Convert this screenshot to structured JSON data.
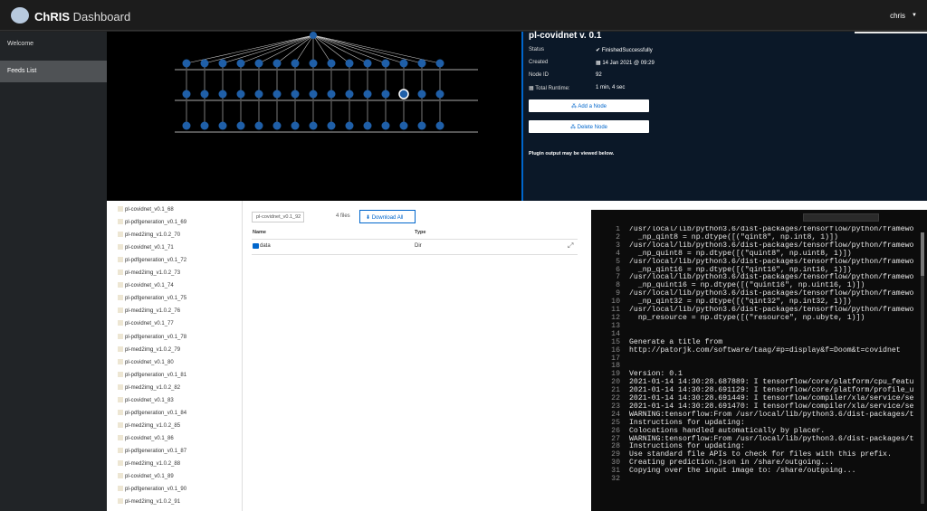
{
  "header": {
    "brand_bold": "ChRIS",
    "brand_rest": "Dashboard",
    "user": "chris"
  },
  "sidebar": {
    "items": [
      {
        "label": "Welcome"
      },
      {
        "label": "Feeds List"
      }
    ]
  },
  "node_detail": {
    "title": "pl-covidnet v. 0.1",
    "rows": [
      {
        "label": "Status",
        "value": "FinishedSuccessfully"
      },
      {
        "label": "Created",
        "value": "14 Jan 2021 @ 09:29"
      },
      {
        "label": "Node ID",
        "value": "92"
      },
      {
        "label": "Total Runtime:",
        "value": "1 min, 4 sec"
      }
    ],
    "add_node": "Add a Node",
    "delete_node": "Delete Node",
    "plugin_message": "Plugin output may be viewed below."
  },
  "feed_list": [
    "pl-covidnet_v0.1_68",
    "pl-pdfgeneration_v0.1_69",
    "pl-med2img_v1.0.2_70",
    "pl-covidnet_v0.1_71",
    "pl-pdfgeneration_v0.1_72",
    "pl-med2img_v1.0.2_73",
    "pl-covidnet_v0.1_74",
    "pl-pdfgeneration_v0.1_75",
    "pl-med2img_v1.0.2_76",
    "pl-covidnet_v0.1_77",
    "pl-pdfgeneration_v0.1_78",
    "pl-med2img_v1.0.2_79",
    "pl-covidnet_v0.1_80",
    "pl-pdfgeneration_v0.1_81",
    "pl-med2img_v1.0.2_82",
    "pl-covidnet_v0.1_83",
    "pl-pdfgeneration_v0.1_84",
    "pl-med2img_v1.0.2_85",
    "pl-covidnet_v0.1_86",
    "pl-pdfgeneration_v0.1_87",
    "pl-med2img_v1.0.2_88",
    "pl-covidnet_v0.1_89",
    "pl-pdfgeneration_v0.1_90",
    "pl-med2img_v1.0.2_91"
  ],
  "file_browser": {
    "path": "pl-covidnet_v0.1_92",
    "count": "4 files",
    "download_all": "Download All",
    "col_name": "Name",
    "col_type": "Type",
    "row": {
      "name": "data",
      "type": "Dir"
    }
  },
  "terminal": {
    "lines": [
      {
        "n": "1",
        "t": "/usr/local/lib/python3.6/dist-packages/tensorflow/python/framewo"
      },
      {
        "n": "2",
        "t": "  _np_qint8 = np.dtype([(\"qint8\", np.int8, 1)])"
      },
      {
        "n": "3",
        "t": "/usr/local/lib/python3.6/dist-packages/tensorflow/python/framewo"
      },
      {
        "n": "4",
        "t": "  _np_quint8 = np.dtype([(\"quint8\", np.uint8, 1)])"
      },
      {
        "n": "5",
        "t": "/usr/local/lib/python3.6/dist-packages/tensorflow/python/framewo"
      },
      {
        "n": "6",
        "t": "  _np_qint16 = np.dtype([(\"qint16\", np.int16, 1)])"
      },
      {
        "n": "7",
        "t": "/usr/local/lib/python3.6/dist-packages/tensorflow/python/framewo"
      },
      {
        "n": "8",
        "t": "  _np_quint16 = np.dtype([(\"quint16\", np.uint16, 1)])"
      },
      {
        "n": "9",
        "t": "/usr/local/lib/python3.6/dist-packages/tensorflow/python/framewo"
      },
      {
        "n": "10",
        "t": "  _np_qint32 = np.dtype([(\"qint32\", np.int32, 1)])"
      },
      {
        "n": "11",
        "t": "/usr/local/lib/python3.6/dist-packages/tensorflow/python/framewo"
      },
      {
        "n": "12",
        "t": "  np_resource = np.dtype([(\"resource\", np.ubyte, 1)])"
      },
      {
        "n": "13",
        "t": ""
      },
      {
        "n": "14",
        "t": ""
      },
      {
        "n": "15",
        "t": "Generate a title from"
      },
      {
        "n": "16",
        "t": "http://patorjk.com/software/taag/#p=display&f=Doom&t=covidnet"
      },
      {
        "n": "17",
        "t": ""
      },
      {
        "n": "18",
        "t": ""
      },
      {
        "n": "19",
        "t": "Version: 0.1"
      },
      {
        "n": "20",
        "t": "2021-01-14 14:30:28.687889: I tensorflow/core/platform/cpu_featu"
      },
      {
        "n": "21",
        "t": "2021-01-14 14:30:28.691129: I tensorflow/core/platform/profile_u"
      },
      {
        "n": "22",
        "t": "2021-01-14 14:30:28.691449: I tensorflow/compiler/xla/service/se"
      },
      {
        "n": "23",
        "t": "2021-01-14 14:30:28.691470: I tensorflow/compiler/xla/service/se"
      },
      {
        "n": "24",
        "t": "WARNING:tensorflow:From /usr/local/lib/python3.6/dist-packages/t"
      },
      {
        "n": "25",
        "t": "Instructions for updating:"
      },
      {
        "n": "26",
        "t": "Colocations handled automatically by placer."
      },
      {
        "n": "27",
        "t": "WARNING:tensorflow:From /usr/local/lib/python3.6/dist-packages/t"
      },
      {
        "n": "28",
        "t": "Instructions for updating:"
      },
      {
        "n": "29",
        "t": "Use standard file APIs to check for files with this prefix."
      },
      {
        "n": "30",
        "t": "Creating prediction.json in /share/outgoing..."
      },
      {
        "n": "31",
        "t": "Copying over the input image to: /share/outgoing..."
      },
      {
        "n": "32",
        "t": ""
      }
    ]
  },
  "colors": {
    "node": "#1f5fa8",
    "accent": "#0066cc",
    "selected_node_ring": "#ffffff"
  }
}
